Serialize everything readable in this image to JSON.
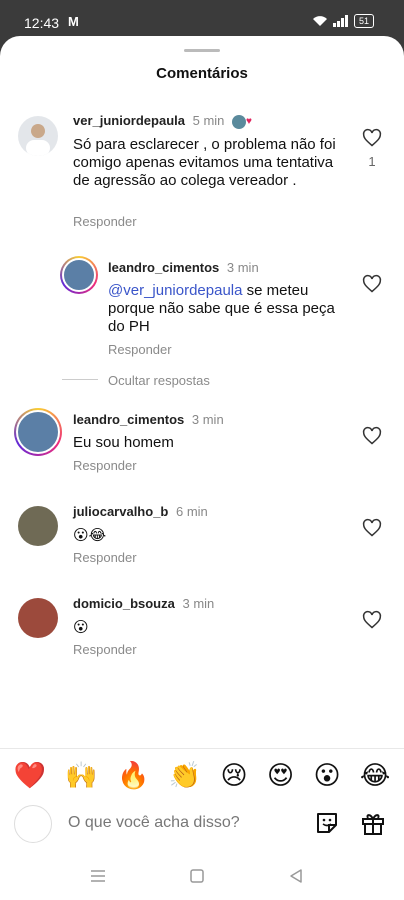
{
  "status": {
    "time": "12:43",
    "app_icon": "M",
    "battery": "51"
  },
  "sheet": {
    "title": "Comentários"
  },
  "comments": [
    {
      "user": "ver_juniordepaula",
      "time": "5 min",
      "text": "Só para esclarecer , o problema não foi comigo apenas evitamos uma tentativa de agressão ao colega vereador .",
      "reply_label": "Responder",
      "likes": "1",
      "avatar_color": "#e3e6ea"
    },
    {
      "user": "leandro_cimentos",
      "time": "3 min",
      "mention": "@ver_juniordepaula",
      "text": " se meteu porque não sabe que é essa peça do PH",
      "reply_label": "Responder",
      "avatar_color": "#5b7fa6"
    },
    {
      "user": "leandro_cimentos",
      "time": "3 min",
      "text": "Eu sou homem",
      "reply_label": "Responder",
      "avatar_color": "#5b7fa6"
    },
    {
      "user": "juliocarvalho_b",
      "time": "6 min",
      "text": "😮😂",
      "reply_label": "Responder",
      "avatar_color": "#6f6a55"
    },
    {
      "user": "domicio_bsouza",
      "time": "3 min",
      "text": "😮",
      "reply_label": "Responder",
      "avatar_color": "#9c4a3c"
    }
  ],
  "hide_replies_label": "Ocultar respostas",
  "emoji_bar": [
    "❤️",
    "🙌",
    "🔥",
    "👏",
    "😢",
    "😍",
    "😮",
    "😂"
  ],
  "composer": {
    "placeholder": "O que você acha disso?"
  },
  "icons": [
    "heart-icon",
    "sticker-icon",
    "gift-icon",
    "menu-icon",
    "home-icon",
    "back-icon"
  ]
}
